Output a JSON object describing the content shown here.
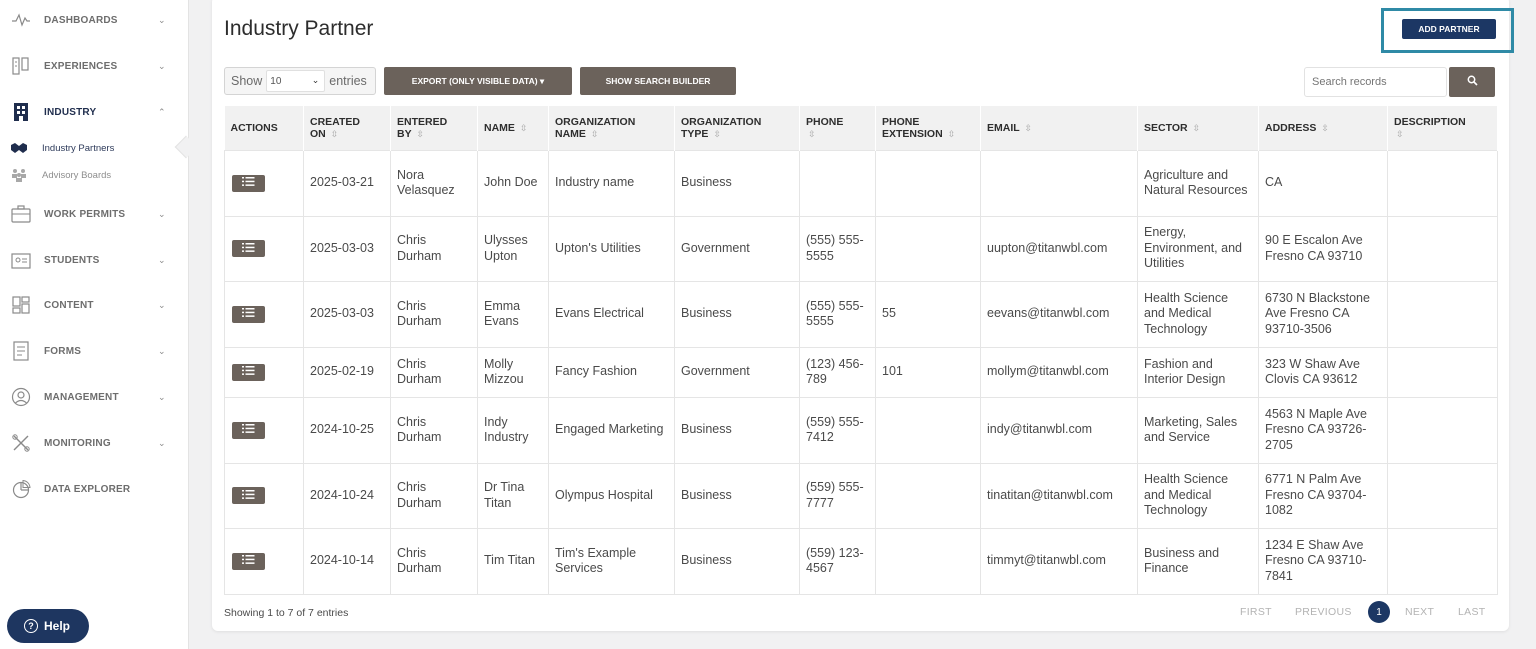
{
  "sidebar": {
    "items": [
      {
        "label": "DASHBOARDS",
        "icon": "pulse-icon",
        "chevron": "⌄"
      },
      {
        "label": "EXPERIENCES",
        "icon": "experiences-icon",
        "chevron": "⌄"
      },
      {
        "label": "INDUSTRY",
        "icon": "building-icon",
        "chevron": "⌃"
      },
      {
        "label": "WORK PERMITS",
        "icon": "briefcase-icon",
        "chevron": "⌄"
      },
      {
        "label": "STUDENTS",
        "icon": "student-id-icon",
        "chevron": "⌄"
      },
      {
        "label": "CONTENT",
        "icon": "content-grid-icon",
        "chevron": "⌄"
      },
      {
        "label": "FORMS",
        "icon": "form-icon",
        "chevron": "⌄"
      },
      {
        "label": "MANAGEMENT",
        "icon": "user-circle-icon",
        "chevron": "⌄"
      },
      {
        "label": "MONITORING",
        "icon": "tools-icon",
        "chevron": "⌄"
      },
      {
        "label": "DATA EXPLORER",
        "icon": "pie-chart-icon",
        "chevron": ""
      }
    ],
    "sub_items": [
      {
        "label": "Industry Partners",
        "icon": "handshake-icon"
      },
      {
        "label": "Advisory Boards",
        "icon": "group-icon"
      }
    ],
    "help_label": "Help"
  },
  "header": {
    "title": "Industry Partner",
    "add_button": "ADD PARTNER"
  },
  "toolbar": {
    "show_label": "Show",
    "show_value": "10",
    "entries_label": "entries",
    "export_button": "EXPORT (ONLY VISIBLE DATA) ▾",
    "search_builder_button": "SHOW SEARCH BUILDER",
    "search_placeholder": "Search records"
  },
  "table": {
    "headers": [
      {
        "line1": "ACTIONS",
        "line2": "",
        "sortable": false
      },
      {
        "line1": "CREATED",
        "line2": "ON",
        "sortable": true
      },
      {
        "line1": "ENTERED",
        "line2": "BY",
        "sortable": true
      },
      {
        "line1": "NAME",
        "line2": "",
        "sortable": true
      },
      {
        "line1": "ORGANIZATION",
        "line2": "NAME",
        "sortable": true
      },
      {
        "line1": "ORGANIZATION",
        "line2": "TYPE",
        "sortable": true
      },
      {
        "line1": "PHONE",
        "line2": "",
        "sortable": true
      },
      {
        "line1": "PHONE",
        "line2": "EXTENSION",
        "sortable": true
      },
      {
        "line1": "EMAIL",
        "line2": "",
        "sortable": true
      },
      {
        "line1": "SECTOR",
        "line2": "",
        "sortable": true
      },
      {
        "line1": "ADDRESS",
        "line2": "",
        "sortable": true
      },
      {
        "line1": "DESCRIPTION",
        "line2": "",
        "sortable": true
      }
    ],
    "sort_glyph": "⇳",
    "rows": [
      {
        "created": "2025-03-21",
        "entered_by": "Nora Velasquez",
        "name": "John Doe",
        "org_name": "Industry name",
        "org_type": "Business",
        "phone": "",
        "ext": "",
        "email": "",
        "sector": "Agriculture and Natural Resources",
        "address": "CA",
        "description": ""
      },
      {
        "created": "2025-03-03",
        "entered_by": "Chris Durham",
        "name": "Ulysses Upton",
        "org_name": "Upton's Utilities",
        "org_type": "Government",
        "phone": "(555) 555-5555",
        "ext": "",
        "email": "uupton@titanwbl.com",
        "sector": "Energy, Environment, and Utilities",
        "address": "90 E Escalon Ave Fresno CA 93710",
        "description": ""
      },
      {
        "created": "2025-03-03",
        "entered_by": "Chris Durham",
        "name": "Emma Evans",
        "org_name": "Evans Electrical",
        "org_type": "Business",
        "phone": "(555) 555-5555",
        "ext": "55",
        "email": "eevans@titanwbl.com",
        "sector": "Health Science and Medical Technology",
        "address": "6730 N Blackstone Ave Fresno CA 93710-3506",
        "description": ""
      },
      {
        "created": "2025-02-19",
        "entered_by": "Chris Durham",
        "name": "Molly Mizzou",
        "org_name": "Fancy Fashion",
        "org_type": "Government",
        "phone": "(123) 456-789",
        "ext": "101",
        "email": "mollym@titanwbl.com",
        "sector": "Fashion and Interior Design",
        "address": "323 W Shaw Ave Clovis CA 93612",
        "description": ""
      },
      {
        "created": "2024-10-25",
        "entered_by": "Chris Durham",
        "name": "Indy Industry",
        "org_name": "Engaged Marketing",
        "org_type": "Business",
        "phone": "(559) 555-7412",
        "ext": "",
        "email": "indy@titanwbl.com",
        "sector": "Marketing, Sales and Service",
        "address": "4563 N Maple Ave Fresno CA 93726-2705",
        "description": ""
      },
      {
        "created": "2024-10-24",
        "entered_by": "Chris Durham",
        "name": "Dr Tina Titan",
        "org_name": "Olympus Hospital",
        "org_type": "Business",
        "phone": "(559) 555-7777",
        "ext": "",
        "email": "tinatitan@titanwbl.com",
        "sector": "Health Science and Medical Technology",
        "address": "6771 N Palm Ave Fresno CA 93704-1082",
        "description": ""
      },
      {
        "created": "2024-10-14",
        "entered_by": "Chris Durham",
        "name": "Tim Titan",
        "org_name": "Tim's Example Services",
        "org_type": "Business",
        "phone": "(559) 123-4567",
        "ext": "",
        "email": "timmyt@titanwbl.com",
        "sector": "Business and Finance",
        "address": "1234 E Shaw Ave Fresno CA 93710-7841",
        "description": ""
      }
    ]
  },
  "footer": {
    "info": "Showing 1 to 7 of 7 entries",
    "first": "FIRST",
    "previous": "PREVIOUS",
    "page": "1",
    "next": "NEXT",
    "last": "LAST"
  },
  "colors": {
    "brand_navy": "#1c3764",
    "button_brown": "#6b625b",
    "highlight_teal": "#2f8aa6"
  }
}
